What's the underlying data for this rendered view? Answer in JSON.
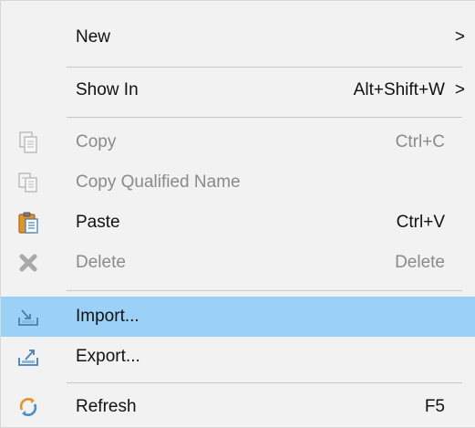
{
  "menu": {
    "items": [
      {
        "label": "New",
        "shortcut": "",
        "submenu_arrow": ">",
        "icon": "",
        "enabled": true
      },
      {
        "label": "Show In",
        "shortcut": "Alt+Shift+W",
        "submenu_arrow": ">",
        "icon": "",
        "enabled": true
      },
      {
        "label": "Copy",
        "shortcut": "Ctrl+C",
        "icon": "copy-icon",
        "enabled": false
      },
      {
        "label": "Copy Qualified Name",
        "shortcut": "",
        "icon": "copy-qualified-name-icon",
        "enabled": false
      },
      {
        "label": "Paste",
        "shortcut": "Ctrl+V",
        "icon": "paste-icon",
        "enabled": true
      },
      {
        "label": "Delete",
        "shortcut": "Delete",
        "icon": "delete-icon",
        "enabled": false
      },
      {
        "label": "Import...",
        "shortcut": "",
        "icon": "import-icon",
        "enabled": true,
        "highlighted": true
      },
      {
        "label": "Export...",
        "shortcut": "",
        "icon": "export-icon",
        "enabled": true
      },
      {
        "label": "Refresh",
        "shortcut": "F5",
        "icon": "refresh-icon",
        "enabled": true
      }
    ]
  },
  "colors": {
    "menu_background": "#f2f2f2",
    "highlight": "#9bd0f7",
    "separator": "#c8c8c8",
    "disabled_text": "#8a8a8a"
  }
}
